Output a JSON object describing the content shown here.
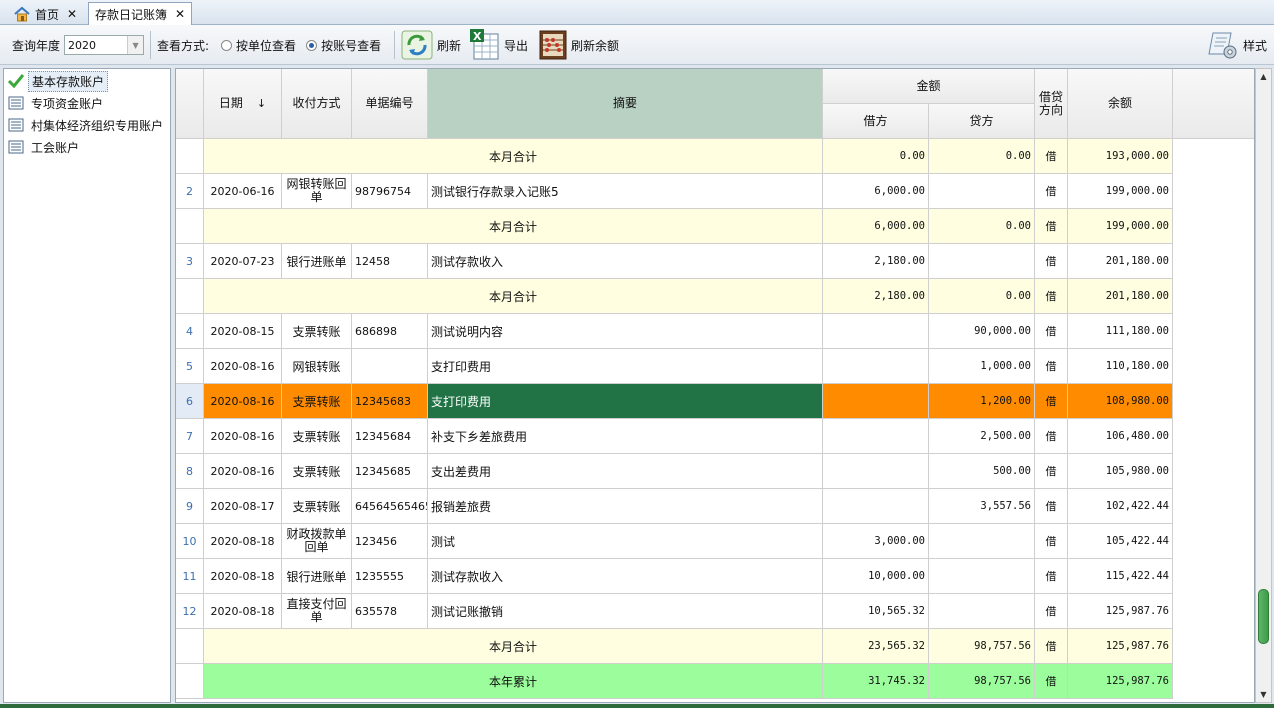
{
  "tabs": [
    {
      "label": "首页"
    },
    {
      "label": "存款日记账簿"
    }
  ],
  "toolbar": {
    "year_label": "查询年度",
    "year_value": "2020",
    "view_label": "查看方式:",
    "radio_unit": "按单位查看",
    "radio_account": "按账号查看",
    "selected_view": "按账号查看",
    "refresh": "刷新",
    "export": "导出",
    "refresh_balance": "刷新余额",
    "style": "样式"
  },
  "accounts": [
    {
      "label": "基本存款账户",
      "selected": true
    },
    {
      "label": "专项资金账户",
      "selected": false
    },
    {
      "label": "村集体经济组织专用账户",
      "selected": false
    },
    {
      "label": "工会账户",
      "selected": false
    }
  ],
  "table": {
    "headers": {
      "date": "日期",
      "sort": "↓",
      "method": "收付方式",
      "doc_no": "单据编号",
      "summary": "摘要",
      "amount": "金额",
      "debit": "借方",
      "credit": "贷方",
      "direction": "借贷方向",
      "balance": "余额"
    },
    "rows": [
      {
        "type": "subtotal",
        "summary": "本月合计",
        "debit": "0.00",
        "credit": "0.00",
        "dir": "借",
        "balance": "193,000.00"
      },
      {
        "type": "entry",
        "idx": "2",
        "date": "2020-06-16",
        "method": "网银转账回单",
        "doc": "98796754",
        "summary": "测试银行存款录入记账5",
        "debit": "6,000.00",
        "credit": "",
        "dir": "借",
        "balance": "199,000.00"
      },
      {
        "type": "subtotal",
        "summary": "本月合计",
        "debit": "6,000.00",
        "credit": "0.00",
        "dir": "借",
        "balance": "199,000.00"
      },
      {
        "type": "entry",
        "idx": "3",
        "date": "2020-07-23",
        "method": "银行进账单",
        "doc": "12458",
        "summary": "测试存款收入",
        "debit": "2,180.00",
        "credit": "",
        "dir": "借",
        "balance": "201,180.00"
      },
      {
        "type": "subtotal",
        "summary": "本月合计",
        "debit": "2,180.00",
        "credit": "0.00",
        "dir": "借",
        "balance": "201,180.00"
      },
      {
        "type": "entry",
        "idx": "4",
        "date": "2020-08-15",
        "method": "支票转账",
        "doc": "686898",
        "summary": "测试说明内容",
        "debit": "",
        "credit": "90,000.00",
        "dir": "借",
        "balance": "111,180.00"
      },
      {
        "type": "entry",
        "idx": "5",
        "date": "2020-08-16",
        "method": "网银转账",
        "doc": "",
        "summary": "支打印费用",
        "debit": "",
        "credit": "1,000.00",
        "dir": "借",
        "balance": "110,180.00"
      },
      {
        "type": "selected",
        "idx": "6",
        "date": "2020-08-16",
        "method": "支票转账",
        "doc": "12345683",
        "summary": "支打印费用",
        "debit": "",
        "credit": "1,200.00",
        "dir": "借",
        "balance": "108,980.00"
      },
      {
        "type": "entry",
        "idx": "7",
        "date": "2020-08-16",
        "method": "支票转账",
        "doc": "12345684",
        "summary": "补支下乡差旅费用",
        "debit": "",
        "credit": "2,500.00",
        "dir": "借",
        "balance": "106,480.00"
      },
      {
        "type": "entry",
        "idx": "8",
        "date": "2020-08-16",
        "method": "支票转账",
        "doc": "12345685",
        "summary": "支出差费用",
        "debit": "",
        "credit": "500.00",
        "dir": "借",
        "balance": "105,980.00"
      },
      {
        "type": "entry",
        "idx": "9",
        "date": "2020-08-17",
        "method": "支票转账",
        "doc": "64564565465",
        "summary": "报销差旅费",
        "debit": "",
        "credit": "3,557.56",
        "dir": "借",
        "balance": "102,422.44"
      },
      {
        "type": "entry",
        "idx": "10",
        "date": "2020-08-18",
        "method": "财政拨款单回单",
        "doc": "123456",
        "summary": "测试",
        "debit": "3,000.00",
        "credit": "",
        "dir": "借",
        "balance": "105,422.44"
      },
      {
        "type": "entry",
        "idx": "11",
        "date": "2020-08-18",
        "method": "银行进账单",
        "doc": "1235555",
        "summary": "测试存款收入",
        "debit": "10,000.00",
        "credit": "",
        "dir": "借",
        "balance": "115,422.44"
      },
      {
        "type": "entry",
        "idx": "12",
        "date": "2020-08-18",
        "method": "直接支付回单",
        "doc": "635578",
        "summary": "测试记账撤销",
        "debit": "10,565.32",
        "credit": "",
        "dir": "借",
        "balance": "125,987.76"
      },
      {
        "type": "subtotal",
        "summary": "本月合计",
        "debit": "23,565.32",
        "credit": "98,757.56",
        "dir": "借",
        "balance": "125,987.76"
      },
      {
        "type": "yeartotal",
        "summary": "本年累计",
        "debit": "31,745.32",
        "credit": "98,757.56",
        "dir": "借",
        "balance": "125,987.76"
      }
    ]
  },
  "colors": {
    "subtotal_bg": "#fffee0",
    "yeartotal_bg": "#9cfd9c",
    "selected_bg": "#ff8c00",
    "selected_summary_bg": "#217346",
    "summary_header_bg": "#b8d1c3"
  }
}
